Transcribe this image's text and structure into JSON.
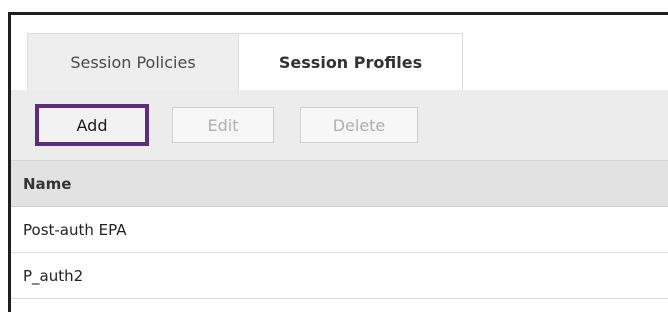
{
  "tabs": [
    {
      "label": "Session Policies",
      "active": false
    },
    {
      "label": "Session Profiles",
      "active": true
    }
  ],
  "toolbar": {
    "add_label": "Add",
    "edit_label": "Edit",
    "delete_label": "Delete"
  },
  "table": {
    "columns": [
      "Name"
    ],
    "rows": [
      {
        "name": "Post-auth EPA"
      },
      {
        "name": "P_auth2"
      }
    ]
  },
  "colors": {
    "highlight": "#5c2d7f",
    "toolbar_bg": "#ececec",
    "header_bg": "#e2e2e2"
  }
}
